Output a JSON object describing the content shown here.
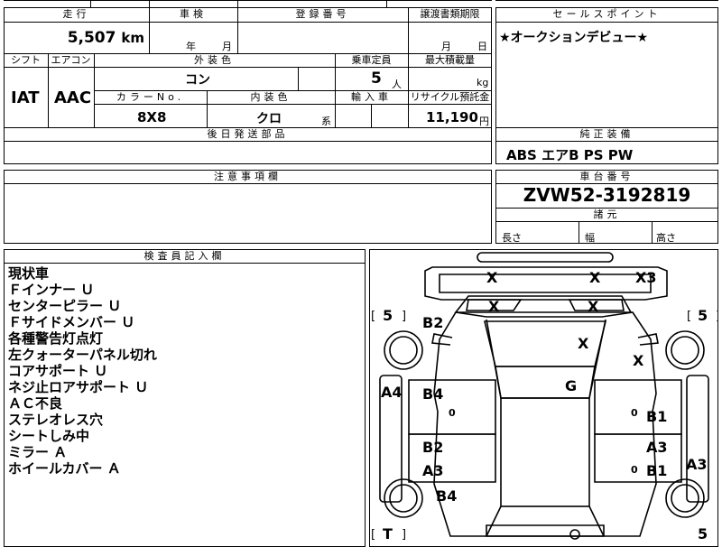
{
  "top": {
    "mileage_label": "走行",
    "mileage_value": "5,507",
    "mileage_unit": "km",
    "inspection_label": "車検",
    "inspection_year": "年",
    "inspection_month": "月",
    "registration_label": "登録番号",
    "transfer_label": "譲渡書類期限",
    "transfer_month": "月",
    "transfer_day": "日",
    "shift_label": "シフト",
    "shift_value": "IAT",
    "ac_label": "エアコン",
    "ac_value": "AAC",
    "exterior_label": "外装色",
    "exterior_value": "コン",
    "capacity_label": "乗車定員",
    "capacity_value": "5",
    "capacity_unit": "人",
    "maxload_label": "最大積載量",
    "maxload_unit": "kg",
    "colorno_label": "カラーNo.",
    "colorno_value": "8X8",
    "interior_label": "内装色",
    "interior_value": "クロ",
    "interior_unit": "系",
    "import_label": "輸入車",
    "recycle_label": "リサイクル預託金",
    "recycle_value": "11,190",
    "recycle_unit": "円",
    "parts_label": "後日発送部品"
  },
  "sales": {
    "label": "セールスポイント",
    "text": "★オークションデビュー★"
  },
  "equipment": {
    "label": "純正装備",
    "value": "ABS エアB PS PW"
  },
  "caution": {
    "label": "注意事項欄"
  },
  "chassis": {
    "label": "車台番号",
    "value": "ZVW52-3192819",
    "dims_label": "諸元",
    "length_label": "長さ",
    "width_label": "幅",
    "height_label": "高さ"
  },
  "inspector": {
    "label": "検査員記入欄",
    "notes": [
      "現状車",
      "Ｆインナー Ｕ",
      "センターピラー Ｕ",
      "Ｆサイドメンバー Ｕ",
      "各種警告灯点灯",
      "左クォーターパネル切れ",
      "コアサポート Ｕ",
      "ネジ止ロアサポート Ｕ",
      "ＡＣ不良",
      "ステレオレス穴",
      "シートしみ中",
      "ミラー Ａ",
      "ホイールカバー Ａ"
    ]
  },
  "diagram": {
    "marks": {
      "front_x1": "X",
      "front_x2": "X",
      "front_x3": "X3",
      "hood_x1": "X",
      "hood_x2": "X",
      "windshield_x": "X",
      "right_fender_x": "X",
      "left_wheel_front": "5",
      "right_wheel_front": "5",
      "left_fender": "B2",
      "left_front_door": "B4",
      "left_rear_door": "B2",
      "left_rear_door_2": "A3",
      "left_quarter": "B4",
      "left_pillar": "A4",
      "roof": "G",
      "right_front_door": "B1",
      "right_rear_door": "A3",
      "right_rear_door_2": "B1",
      "right_quarter": "A3",
      "left_small_1": "0",
      "right_small_1": "0",
      "right_small_2": "0",
      "rear_left": "T",
      "rear_right": "5"
    }
  }
}
